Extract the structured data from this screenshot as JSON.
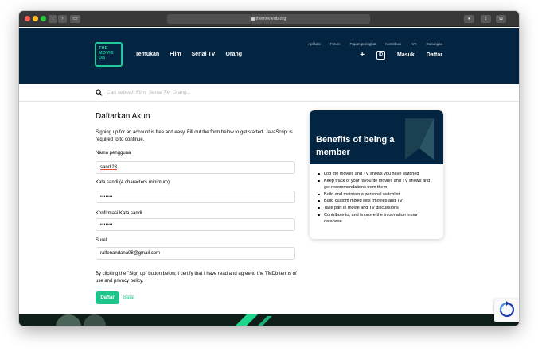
{
  "browser": {
    "url": "themoviedb.org"
  },
  "header": {
    "logo": [
      "THE",
      "MOVIE",
      "DB"
    ],
    "main_nav": [
      "Temukan",
      "Film",
      "Serial TV",
      "Orang"
    ],
    "sub_nav": [
      "Aplikasi",
      "Forum",
      "Papan peringkat",
      "Kontribusi",
      "API",
      "Dukungan"
    ],
    "login": "Masuk",
    "signup": "Daftar",
    "lang": "ID"
  },
  "search": {
    "placeholder": "Cari sebuah Film, Serial TV, Orang..."
  },
  "form": {
    "title": "Daftarkan Akun",
    "intro": "Signing up for an account is free and easy. Fill out the form below to get started. JavaScript is required to to continue.",
    "username_label": "Nama pengguna",
    "username_value": "sandi23",
    "password_label": "Kata sandi (4 characters minimum)",
    "password_value": "•••••••",
    "confirm_label": "Konfirmasi Kata sandi",
    "confirm_value": "•••••••",
    "email_label": "Surel",
    "email_value": "ralfenandana08@gmail.com",
    "terms": "By clicking the \"Sign up\" button below, I certify that I have read and agree to the TMDb terms of use and privacy policy.",
    "submit": "Daftar",
    "cancel": "Batal"
  },
  "benefits": {
    "title": "Benefits of being a member",
    "items": [
      "Log the movies and TV shows you have watched",
      "Keep track of your favourite movies and TV shows and get recommendations from them",
      "Build and maintain a personal watchlist",
      "Build custom mixed lists (movies and TV)",
      "Take part in movie and TV discussions",
      "Contribute to, and improve the information in our database"
    ]
  },
  "colors": {
    "header_bg": "#032541",
    "accent_green": "#20c997",
    "button_green": "#1dc58a"
  }
}
